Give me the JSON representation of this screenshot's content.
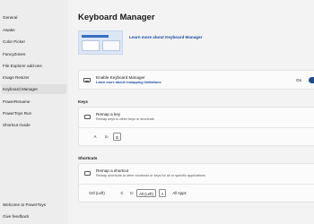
{
  "sidebar": {
    "items": [
      {
        "label": "General"
      },
      {
        "label": "Awake"
      },
      {
        "label": "Color Picker"
      },
      {
        "label": "FancyZones"
      },
      {
        "label": "File Explorer add-ons"
      },
      {
        "label": "Image Resizer"
      },
      {
        "label": "Keyboard Manager",
        "selected": true
      },
      {
        "label": "PowerRename"
      },
      {
        "label": "PowerToys Run"
      },
      {
        "label": "Shortcut Guide"
      }
    ],
    "footer": [
      {
        "label": "Welcome to PowerToys"
      },
      {
        "label": "Give feedback"
      }
    ]
  },
  "main": {
    "title": "Keyboard Manager",
    "hero_link": "Learn more about Keyboard Manager",
    "enable_card": {
      "title": "Enable Keyboard Manager",
      "subtitle": "Learn more about remapping limitations",
      "toggle_label": "On",
      "toggle_on": true
    },
    "keys_section": {
      "label": "Keys",
      "title": "Remap a key",
      "subtitle": "Remap keys to other keys or shortcuts",
      "mapping": {
        "from": "A",
        "to_word": "to",
        "to": "B"
      }
    },
    "shortcuts_section": {
      "label": "Shortcuts",
      "title": "Remap a shortcut",
      "subtitle": "Remap shortcuts to other shortcuts or keys for all or specific applications",
      "mapping": {
        "from": [
          "Ctrl (Left)",
          "C"
        ],
        "to_word": "to",
        "to": [
          "Alt (Left)",
          "A"
        ],
        "target": "All Apps"
      }
    }
  },
  "colors": {
    "accent": "#1a4f8f",
    "link": "#1f4fa0",
    "sidebar_bg": "#ededed",
    "page_bg": "#f3f3f3"
  }
}
